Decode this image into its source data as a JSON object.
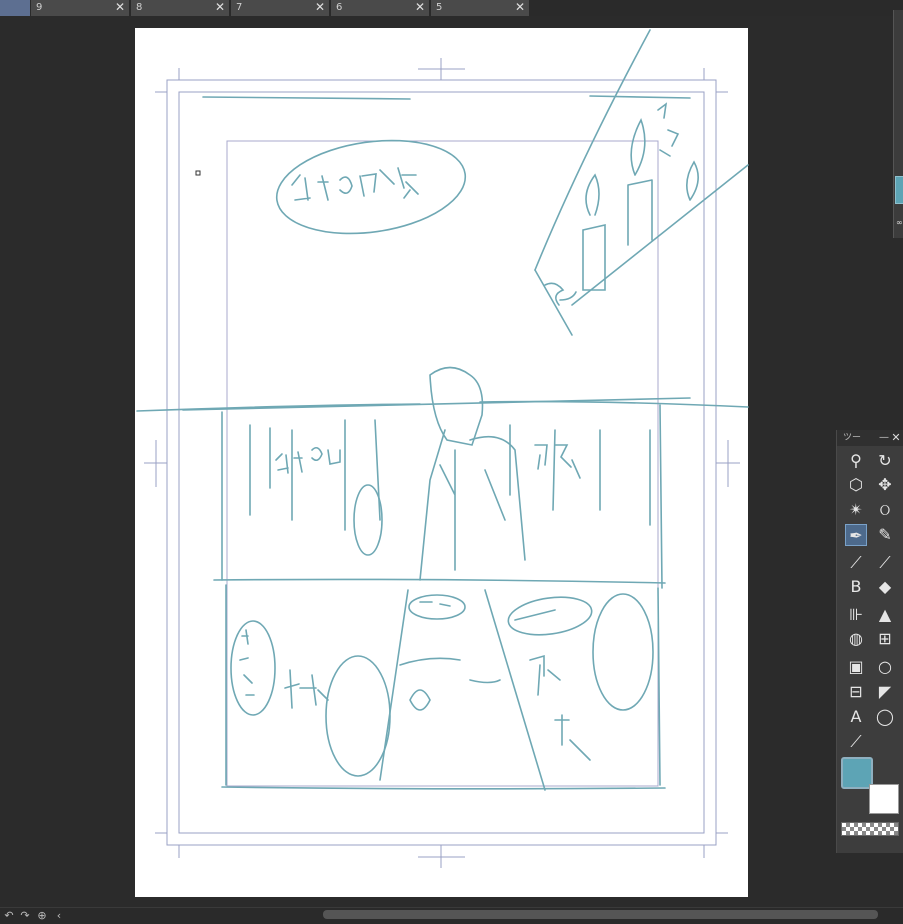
{
  "tabs": [
    {
      "label": "9",
      "close": "✕"
    },
    {
      "label": "8",
      "close": "✕"
    },
    {
      "label": "7",
      "close": "✕"
    },
    {
      "label": "6",
      "close": "✕"
    },
    {
      "label": "5",
      "close": "✕"
    }
  ],
  "tool_panel": {
    "title": "ツー",
    "minimize": "—",
    "close": "✕",
    "tools": [
      {
        "name": "zoom-icon",
        "glyph": "⚲"
      },
      {
        "name": "rotate-icon",
        "glyph": "↻"
      },
      {
        "name": "object-icon",
        "glyph": "⬡"
      },
      {
        "name": "move-icon",
        "glyph": "✥"
      },
      {
        "name": "auto-select-icon",
        "glyph": "✴"
      },
      {
        "name": "lasso-icon",
        "glyph": "ଠ"
      },
      {
        "name": "pen-icon",
        "glyph": "✒"
      },
      {
        "name": "pencil-icon",
        "glyph": "✎"
      },
      {
        "name": "brush-icon",
        "glyph": "⟋"
      },
      {
        "name": "eyedropper-icon",
        "glyph": "⟋"
      },
      {
        "name": "decoration-icon",
        "glyph": "B"
      },
      {
        "name": "eraser-icon",
        "glyph": "◆"
      },
      {
        "name": "airbrush-icon",
        "glyph": "⊪"
      },
      {
        "name": "cake-icon",
        "glyph": "▲"
      },
      {
        "name": "blend-icon",
        "glyph": "◍"
      },
      {
        "name": "frame-icon",
        "glyph": "⊞"
      },
      {
        "name": "gradient-icon",
        "glyph": "▣"
      },
      {
        "name": "ellipse-icon",
        "glyph": "○"
      },
      {
        "name": "ruler-icon",
        "glyph": "⊟"
      },
      {
        "name": "figure-icon",
        "glyph": "◤"
      },
      {
        "name": "text-icon",
        "glyph": "A"
      },
      {
        "name": "balloon-icon",
        "glyph": "◯"
      },
      {
        "name": "correct-line-icon",
        "glyph": "⟋"
      }
    ]
  },
  "colors": {
    "foreground": "#5da4b5",
    "background": "#ffffff",
    "sketch": "#6fa8b4",
    "guide": "#9aa0c4"
  },
  "status_icons": [
    "↶",
    "↷",
    "⊕",
    "‹"
  ]
}
